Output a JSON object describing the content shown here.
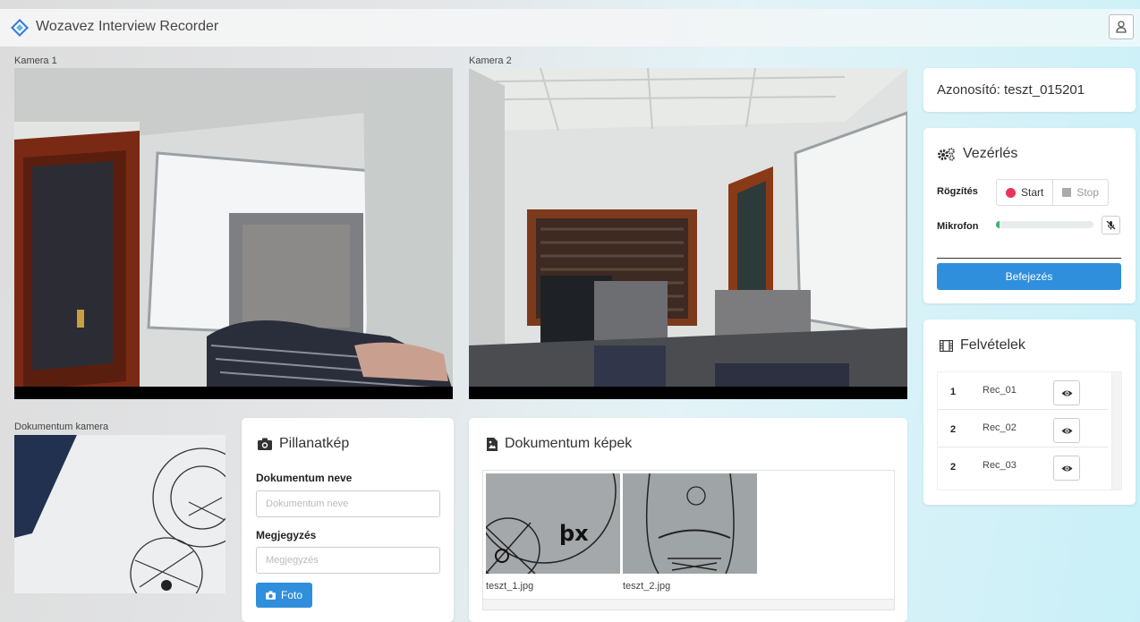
{
  "app": {
    "title": "Wozavez Interview Recorder"
  },
  "cameras": {
    "cam1_label": "Kamera 1",
    "cam2_label": "Kamera 2",
    "doc_label": "Dokumentum kamera"
  },
  "snapshot": {
    "title": "Pillanatkép",
    "doc_name_label": "Dokumentum neve",
    "doc_name_value": "",
    "doc_name_placeholder": "Dokumentum neve",
    "note_label": "Megjegyzés",
    "note_value": "",
    "note_placeholder": "Megjegyzés",
    "photo_button": "Foto"
  },
  "documents": {
    "title": "Dokumentum képek",
    "images": [
      {
        "name": "teszt_1.jpg"
      },
      {
        "name": "teszt_2.jpg"
      }
    ]
  },
  "session": {
    "id_text": "Azonosító: teszt_015201"
  },
  "control": {
    "title": "Vezérlés",
    "record_label": "Rögzítés",
    "start_label": "Start",
    "stop_label": "Stop",
    "mic_label": "Mikrofon",
    "mic_level": 0.04,
    "finish_button": "Befejezés"
  },
  "recordings": {
    "title": "Felvételek",
    "items": [
      {
        "num": "1",
        "name": "Rec_01"
      },
      {
        "num": "2",
        "name": "Rec_02"
      },
      {
        "num": "2",
        "name": "Rec_03"
      }
    ]
  },
  "colors": {
    "accent": "#2f8fdc",
    "record_dot": "#e8335a",
    "mic_level": "#3cb371"
  }
}
